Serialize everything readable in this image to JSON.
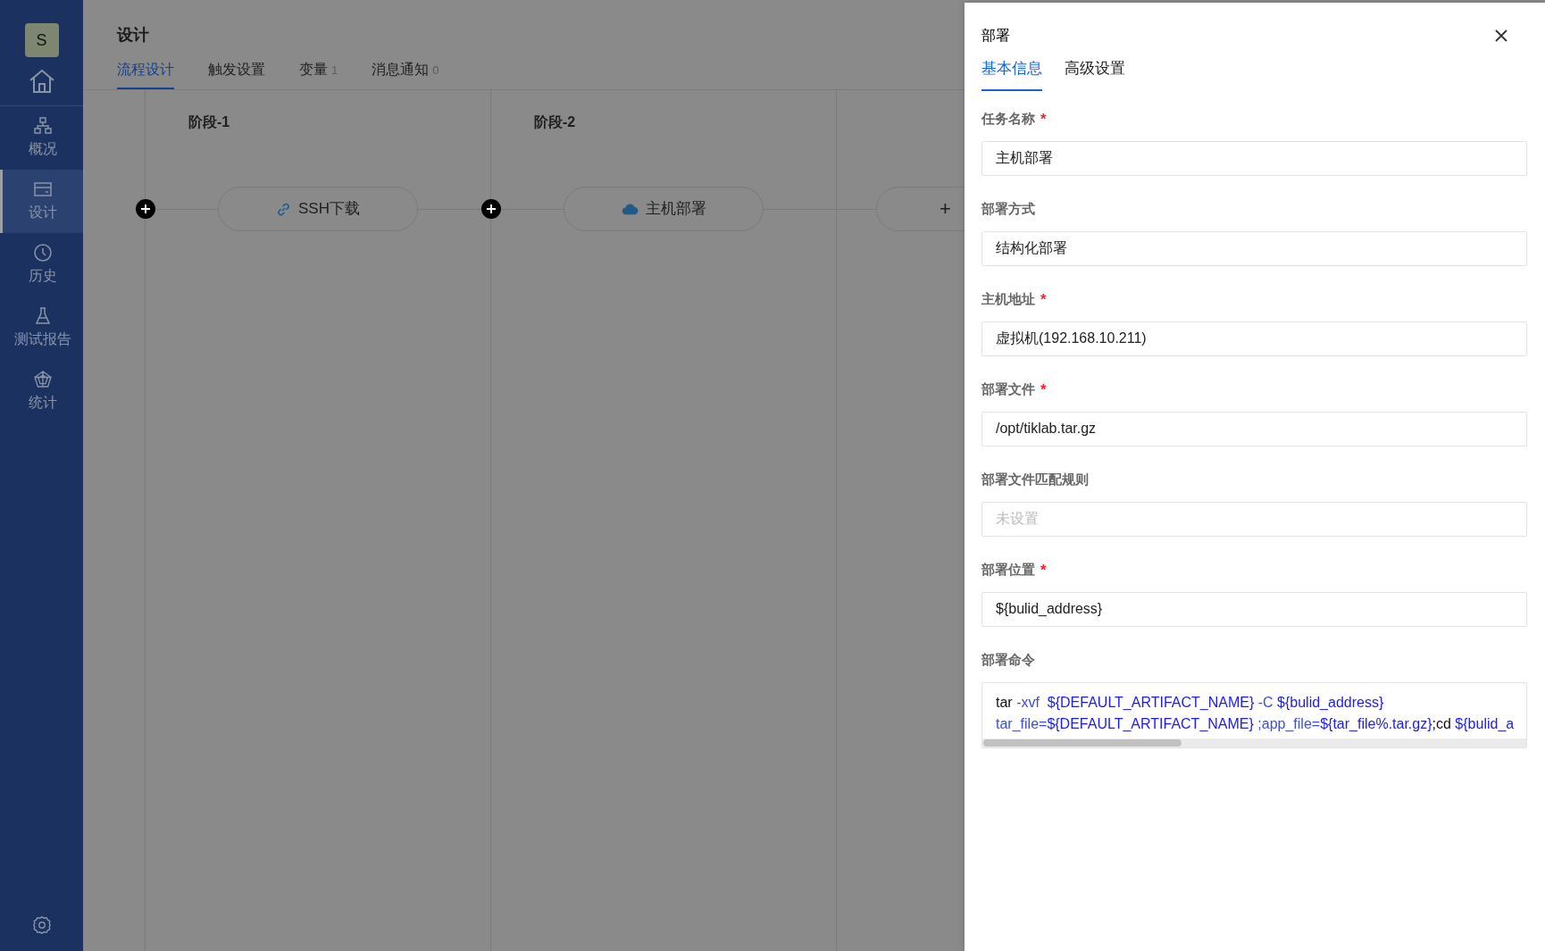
{
  "sidebar": {
    "avatar": "S",
    "items": [
      {
        "label": "概况",
        "selected": false
      },
      {
        "label": "设计",
        "selected": true
      },
      {
        "label": "历史",
        "selected": false
      },
      {
        "label": "测试报告",
        "selected": false
      },
      {
        "label": "统计",
        "selected": false
      }
    ]
  },
  "header": {
    "title": "设计",
    "tabs": [
      {
        "label": "流程设计",
        "selected": true
      },
      {
        "label": "触发设置",
        "selected": false
      },
      {
        "label": "变量",
        "count": "1",
        "selected": false
      },
      {
        "label": "消息通知",
        "count": "0",
        "selected": false
      }
    ]
  },
  "stages": [
    {
      "kind": "stage",
      "title": "阶段-1",
      "task": {
        "label": "SSH下载"
      }
    },
    {
      "kind": "stage",
      "title": "阶段-2",
      "task": {
        "label": "主机部署"
      }
    },
    {
      "kind": "new",
      "task": {
        "label": "+"
      }
    }
  ],
  "drawer": {
    "title": "部署",
    "tabs": [
      {
        "label": "基本信息",
        "selected": true
      },
      {
        "label": "高级设置",
        "selected": false
      }
    ],
    "fields": [
      {
        "label": "任务名称",
        "required_mark": "*",
        "value": "主机部署"
      },
      {
        "label": "部署方式",
        "value": "结构化部署"
      },
      {
        "label": "主机地址",
        "required_mark": "*",
        "value": "虚拟机(192.168.10.211)"
      },
      {
        "label": "部署文件",
        "required_mark": "*",
        "value": "/opt/tiklab.tar.gz"
      },
      {
        "label": "部署文件匹配规则",
        "placeholder": "未设置"
      },
      {
        "label": "部署位置",
        "required_mark": "*",
        "value": "${bulid_address}"
      }
    ],
    "command": {
      "label": "部署命令",
      "lines": [
        [
          {
            "kind": "plain",
            "text": "tar "
          },
          {
            "kind": "option",
            "text": "-xvf  "
          },
          {
            "kind": "variable",
            "text": "${DEFAULT_ARTIFACT_NAME}"
          },
          {
            "kind": "option",
            "text": " -C "
          },
          {
            "kind": "variable",
            "text": "${bulid_address}"
          }
        ],
        [
          {
            "kind": "option",
            "text": "tar_file="
          },
          {
            "kind": "variable",
            "text": "${DEFAULT_ARTIFACT_NAME}"
          },
          {
            "kind": "option",
            "text": " ;app_file="
          },
          {
            "kind": "variable",
            "text": "${tar_file%.tar.gz}"
          },
          {
            "kind": "plain",
            "text": ";cd "
          },
          {
            "kind": "variable",
            "text": "${bulid_a"
          }
        ]
      ]
    }
  }
}
